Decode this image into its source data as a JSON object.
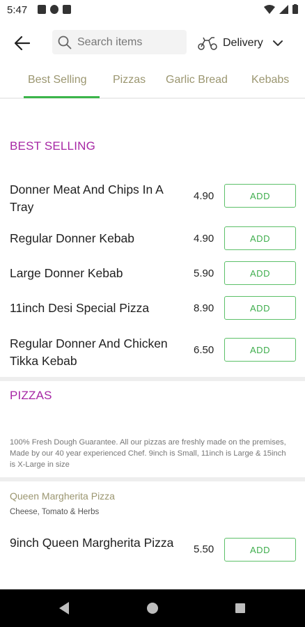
{
  "status": {
    "time": "5:47"
  },
  "search": {
    "placeholder": "Search items"
  },
  "delivery": {
    "label": "Delivery"
  },
  "tabs": [
    {
      "label": "Best Selling"
    },
    {
      "label": "Pizzas"
    },
    {
      "label": "Garlic Bread"
    },
    {
      "label": "Kebabs"
    }
  ],
  "best_selling": {
    "title": "BEST SELLING",
    "items": [
      {
        "name": "Donner Meat And Chips In A Tray",
        "price": "4.90"
      },
      {
        "name": "Regular Donner Kebab",
        "price": "4.90"
      },
      {
        "name": "Large Donner Kebab",
        "price": "5.90"
      },
      {
        "name": "11inch Desi Special Pizza",
        "price": "8.90"
      },
      {
        "name": "Regular Donner And Chicken Tikka Kebab",
        "price": "6.50"
      }
    ]
  },
  "pizzas": {
    "title": "PIZZAS",
    "description": "100% Fresh Dough Guarantee. All our pizzas are freshly made on the premises, Made by our 40 year experienced Chef. 9inch is Small, 11inch is Large & 15inch is X-Large in size",
    "subsection": {
      "title": "Queen Margherita Pizza",
      "description": "Cheese, Tomato & Herbs"
    },
    "items": [
      {
        "name": "9inch Queen Margherita Pizza",
        "price": "5.50"
      }
    ]
  },
  "add_label": "ADD",
  "colors": {
    "accent_green": "#3bb54a",
    "section_purple": "#a626a4",
    "tab_olive": "#9b9670"
  }
}
